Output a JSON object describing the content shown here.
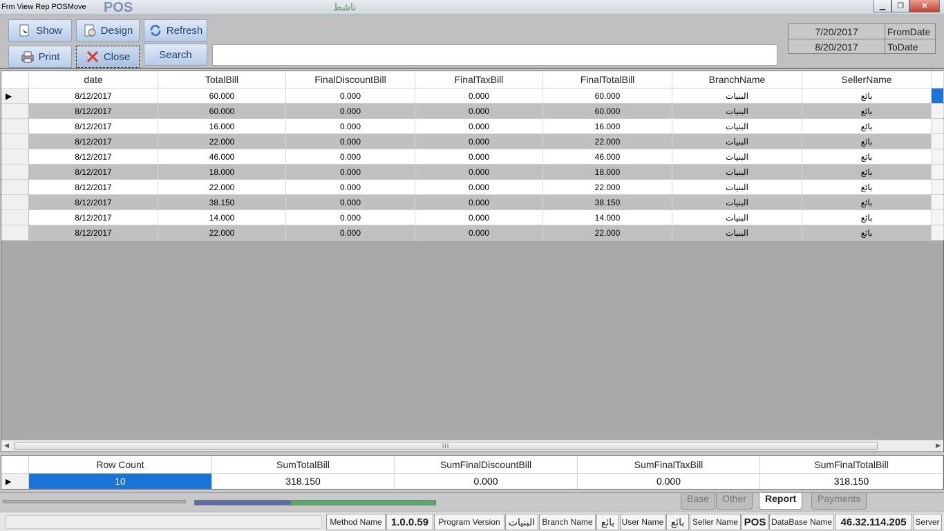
{
  "window": {
    "title": "Frm View Rep POSMove",
    "bg_logo_text": "POS",
    "bg_green_text": "ناشط"
  },
  "toolbar": {
    "show_label": "Show",
    "design_label": "Design",
    "refresh_label": "Refresh",
    "print_label": "Print",
    "close_label": "Close",
    "search_label": "Search",
    "search_value": ""
  },
  "dates": {
    "from_value": "7/20/2017",
    "from_label": "FromDate",
    "to_value": "8/20/2017",
    "to_label": "ToDate"
  },
  "grid": {
    "columns": [
      "date",
      "TotalBill",
      "FinalDiscountBill",
      "FinalTaxBill",
      "FinalTotalBill",
      "BranchName",
      "SellerName"
    ],
    "rows": [
      [
        "8/12/2017",
        "60.000",
        "0.000",
        "0.000",
        "60.000",
        "البنيات",
        "بائع"
      ],
      [
        "8/12/2017",
        "60.000",
        "0.000",
        "0.000",
        "60.000",
        "البنيات",
        "بائع"
      ],
      [
        "8/12/2017",
        "16.000",
        "0.000",
        "0.000",
        "16.000",
        "البنيات",
        "بائع"
      ],
      [
        "8/12/2017",
        "22.000",
        "0.000",
        "0.000",
        "22.000",
        "البنيات",
        "بائع"
      ],
      [
        "8/12/2017",
        "46.000",
        "0.000",
        "0.000",
        "46.000",
        "البنيات",
        "بائع"
      ],
      [
        "8/12/2017",
        "18.000",
        "0.000",
        "0.000",
        "18.000",
        "البنيات",
        "بائع"
      ],
      [
        "8/12/2017",
        "22.000",
        "0.000",
        "0.000",
        "22.000",
        "البنيات",
        "بائع"
      ],
      [
        "8/12/2017",
        "38.150",
        "0.000",
        "0.000",
        "38.150",
        "البنيات",
        "بائع"
      ],
      [
        "8/12/2017",
        "14.000",
        "0.000",
        "0.000",
        "14.000",
        "البنيات",
        "بائع"
      ],
      [
        "8/12/2017",
        "22.000",
        "0.000",
        "0.000",
        "22.000",
        "البنيات",
        "بائع"
      ]
    ],
    "current_row_marker": "▶",
    "scroll_grip": "III"
  },
  "summary": {
    "columns": [
      "Row Count",
      "SumTotalBill",
      "SumFinalDiscountBill",
      "SumFinalTaxBill",
      "SumFinalTotalBill"
    ],
    "values": [
      "10",
      "318.150",
      "0.000",
      "0.000",
      "318.150"
    ]
  },
  "tabs": [
    "Base",
    "Other",
    "Report",
    "Payments"
  ],
  "tabs_active": "Report",
  "status": {
    "method_name_label": "Method Name",
    "version_value": "1.0.0.59",
    "program_version_label": "Program Version",
    "branch_value": "البنيات",
    "branch_label": "Branch Name",
    "user_value": "بائع",
    "user_label": "User Name",
    "seller_value": "بائع",
    "seller_label": "Seller Name",
    "db_value": "POS",
    "db_label": "DataBase Name",
    "server_value": "46.32.114.205",
    "server_label": "Server"
  },
  "colors": {
    "selection": "#1a73d6",
    "button_text": "#1f3f74",
    "alt_row": "#c0c0c0"
  }
}
